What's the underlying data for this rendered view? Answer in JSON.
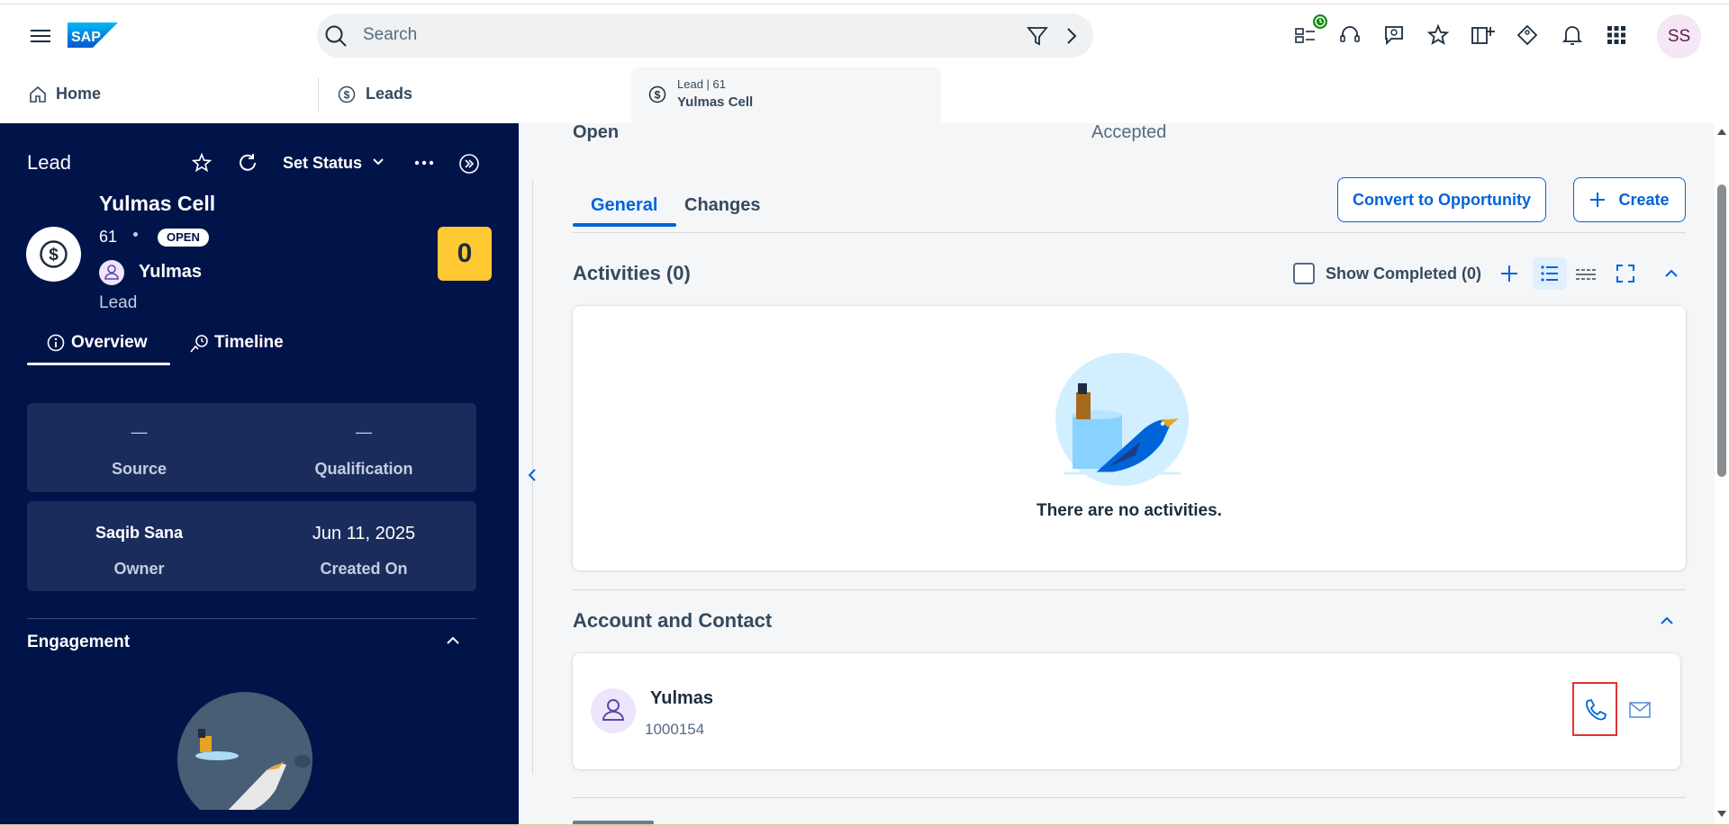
{
  "shell": {
    "search_placeholder": "Search",
    "avatar_initials": "SS",
    "icons": [
      "menu-icon",
      "sap-logo",
      "search-icon",
      "filter-icon",
      "chevron-right-icon",
      "queue-icon",
      "headset-icon",
      "chat-icon",
      "star-icon",
      "add-app-icon",
      "diamond-icon",
      "bell-icon",
      "grid-icon"
    ],
    "badge_color": "#188918"
  },
  "tabs": {
    "home": "Home",
    "leads": "Leads",
    "active_subtitle": "Lead | 61",
    "active_title": "Yulmas Cell"
  },
  "left": {
    "header_title": "Lead",
    "set_status": "Set Status",
    "name": "Yulmas Cell",
    "id": "61",
    "status_badge": "OPEN",
    "contact_name": "Yulmas",
    "type": "Lead",
    "score": "0",
    "tab_overview": "Overview",
    "tab_timeline": "Timeline",
    "source_value": "—",
    "source_label": "Source",
    "qualification_value": "—",
    "qualification_label": "Qualification",
    "owner_value": "Saqib Sana",
    "owner_label": "Owner",
    "created_value": "Jun 11, 2025",
    "created_label": "Created On",
    "engagement_title": "Engagement",
    "score_color": "#ffc933",
    "bg_color": "#00144a"
  },
  "main": {
    "status_left": "Open",
    "status_right": "Accepted",
    "tab_general": "General",
    "tab_changes": "Changes",
    "btn_convert": "Convert to Opportunity",
    "btn_create": "Create",
    "activities_title": "Activities (0)",
    "show_completed": "Show Completed (0)",
    "no_activities": "There are no activities.",
    "account_contact_title": "Account and Contact",
    "contact_name": "Yulmas",
    "contact_id": "1000154",
    "accent_color": "#0064d9"
  }
}
